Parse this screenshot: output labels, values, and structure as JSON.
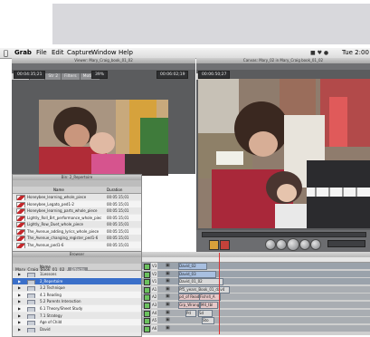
{
  "menubar": {
    "app": "Grab",
    "items": [
      "File",
      "Edit",
      "Capture",
      "Window",
      "Help"
    ],
    "clock": "Tue 2:00 P"
  },
  "viewer": {
    "title": "Viewer: Mary_Craig_book_01_02",
    "tabs": [
      "Video",
      "Str 1",
      "Str 2",
      "Filters",
      "Motion"
    ],
    "duration": "00:04:35;21",
    "zoom": "39%",
    "timecode": "00:06:02;19"
  },
  "canvas": {
    "title": "Canvas: Mary_02 in Mary_Craig book_01_02",
    "sequence_tab": "David_01_02",
    "timecode": "00:06:50;27"
  },
  "bin": {
    "title": "Bin: 2_Repertoire",
    "tab": "2_Repertoire",
    "columns": [
      "Name",
      "Duration"
    ],
    "rows": [
      {
        "name": "Honeybee_learning_whole_piece",
        "duration": "00:05:15;01"
      },
      {
        "name": "Honeybee_Legato_ped1-2",
        "duration": "00:05:15;01"
      },
      {
        "name": "Honeybee_learning_parts_whole_piece",
        "duration": "00:05:15;01"
      },
      {
        "name": "Lightly_Roll_Brt_performance_whole_piece",
        "duration": "00:05:15;01"
      },
      {
        "name": "Lightly_Row_Duet_whole_piece",
        "duration": "00:05:15;01"
      },
      {
        "name": "The_Avenue_adding_lyrics_whole_piece",
        "duration": "00:05:15;01"
      },
      {
        "name": "The_Avenue_changing_register_ped1-6",
        "duration": "00:05:15;01"
      },
      {
        "name": "The_Avenue_ped1-6",
        "duration": "00:05:15;01"
      }
    ]
  },
  "browser": {
    "title": "Browser",
    "tabs": [
      "Mary_Craig_book_01_02",
      "Effects"
    ],
    "column": "Name",
    "items": [
      "1Lessons",
      "2_Repertoire",
      "3.2 Technique",
      "4.1 Reading",
      "5.2 Parents Interaction",
      "6.1 Theory/Sheet Study",
      "7.1 Strategy",
      "Age of Child",
      "David"
    ]
  },
  "timeline": {
    "tracks": [
      "V3",
      "V2",
      "V1",
      "A1",
      "A2",
      "A3",
      "A4",
      "A5",
      "A6"
    ],
    "clips": {
      "v3": "David_02",
      "v2": "David_03",
      "v1": "David_01_02",
      "a1": "Pf5_years_Book_01_dav4",
      "a2a": "pd_of Reading",
      "a2b": "Fishr4_A",
      "a3a": "Grp_Wrangle",
      "a3b": "M4_tbl",
      "a4a": "Pd",
      "a4b": "Sd",
      "a5": "Sto"
    }
  },
  "colors": {
    "accent_blue": "#3a6fc9",
    "panel_dark": "#5b5c5e",
    "clip_blue": "#a8bfe0",
    "clip_green": "#8ea58e",
    "clip_audio": "#d9d9d9"
  }
}
